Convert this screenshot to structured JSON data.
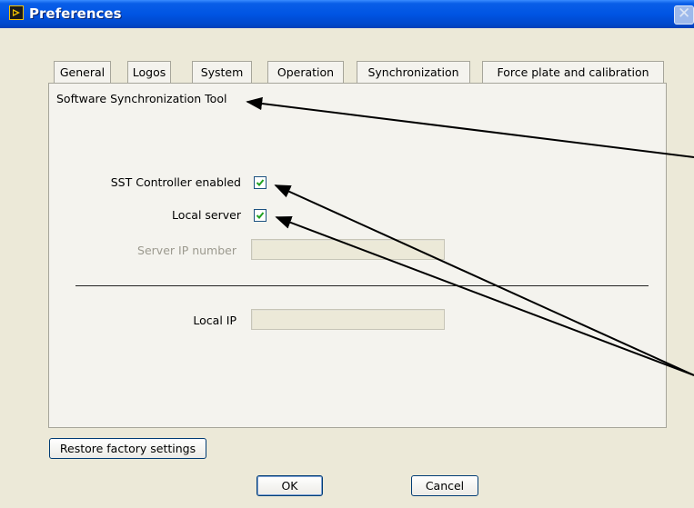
{
  "window": {
    "title": "Preferences",
    "close_glyph": "✕"
  },
  "tabs": [
    {
      "label": "General"
    },
    {
      "label": "Logos"
    },
    {
      "label": "System"
    },
    {
      "label": "Operation"
    },
    {
      "label": "Synchronization",
      "selected": true
    },
    {
      "label": "Force plate and calibration"
    }
  ],
  "panel": {
    "title": "Software Synchronization Tool",
    "sst_controller": {
      "label": "SST Controller enabled",
      "checked": true
    },
    "local_server": {
      "label": "Local server",
      "checked": true
    },
    "server_ip": {
      "label": "Server IP number",
      "value": "",
      "enabled": false
    },
    "local_ip": {
      "label": "Local IP",
      "value": ""
    }
  },
  "buttons": {
    "restore": "Restore factory settings",
    "ok": "OK",
    "cancel": "Cancel"
  },
  "colors": {
    "titlebar": "#0054e3",
    "dialog_bg": "#ece9d8",
    "panel_bg": "#f4f3ee",
    "check": "#21a121"
  }
}
